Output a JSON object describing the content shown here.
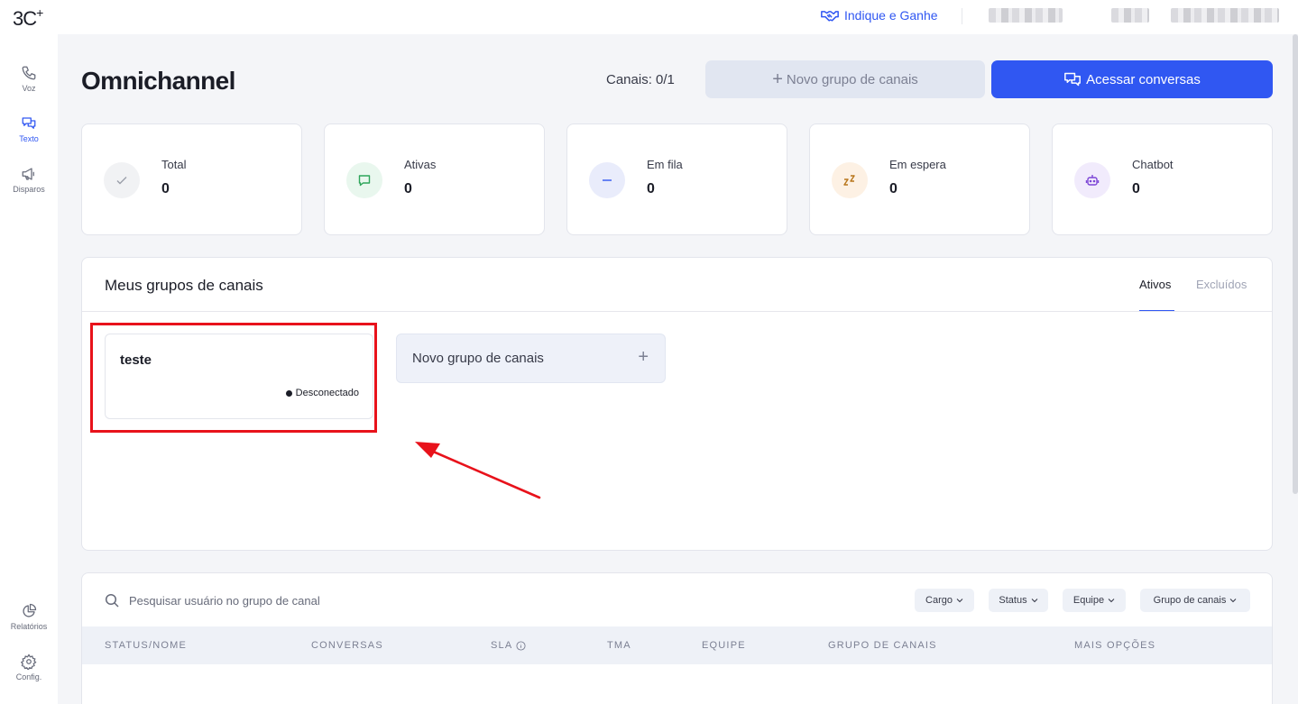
{
  "topbar": {
    "logo": "3C",
    "logo_sup": "+",
    "indique": "Indique e Ganhe"
  },
  "sidebar": {
    "items": [
      {
        "label": "Voz",
        "icon": "phone-icon"
      },
      {
        "label": "Texto",
        "icon": "chat-icon"
      },
      {
        "label": "Disparos",
        "icon": "megaphone-icon"
      },
      {
        "label": "Relatórios",
        "icon": "pie-chart-icon"
      },
      {
        "label": "Config.",
        "icon": "gear-icon"
      }
    ]
  },
  "header": {
    "title": "Omnichannel",
    "canais": "Canais: 0/1",
    "novo_grupo_label": "Novo grupo de canais",
    "acessar_label": "Acessar conversas"
  },
  "stats": [
    {
      "label": "Total",
      "value": "0",
      "icon": "check-icon",
      "color": "#f1f2f4"
    },
    {
      "label": "Ativas",
      "value": "0",
      "icon": "message-icon",
      "color": "#e9f7ee"
    },
    {
      "label": "Em fila",
      "value": "0",
      "icon": "minus-icon",
      "color": "#e9ecfb"
    },
    {
      "label": "Em espera",
      "value": "0",
      "icon": "sleep-icon",
      "color": "#fdf1e4"
    },
    {
      "label": "Chatbot",
      "value": "0",
      "icon": "robot-icon",
      "color": "#f1ebfc"
    }
  ],
  "groups": {
    "title": "Meus grupos de canais",
    "tabs": [
      "Ativos",
      "Excluídos"
    ],
    "cards": [
      {
        "name": "teste",
        "status": "Desconectado"
      }
    ],
    "new_card_label": "Novo grupo de canais",
    "new_card_plus": "+"
  },
  "users": {
    "search_placeholder": "Pesquisar usuário no grupo de canal",
    "filters": [
      "Cargo",
      "Status",
      "Equipe",
      "Grupo de canais"
    ],
    "columns": [
      "STATUS/NOME",
      "CONVERSAS",
      "SLA",
      "TMA",
      "EQUIPE",
      "GRUPO DE CANAIS",
      "MAIS OPÇÕES"
    ]
  },
  "colors": {
    "accent": "#3057f2",
    "highlight": "#e8121b"
  }
}
